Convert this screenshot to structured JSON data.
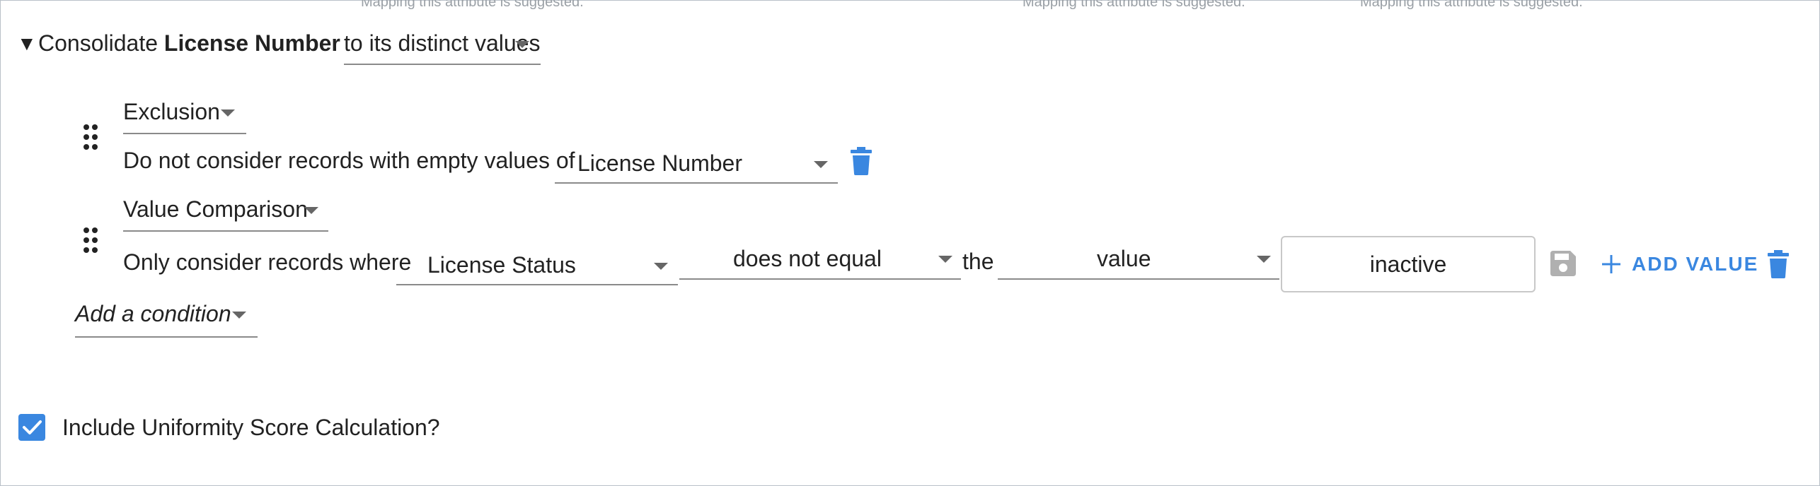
{
  "header_faint": {
    "left": "Mapping this attribute is suggested.",
    "mid": "Mapping this attribute is suggested.",
    "right": "Mapping this attribute is suggested."
  },
  "section": {
    "toggle": "▼",
    "prefix": "Consolidate",
    "attribute": "License Number",
    "mode": "to its distinct values"
  },
  "conditions": [
    {
      "type": "Exclusion",
      "text": "Do not consider records with empty values of",
      "field": "License Number"
    },
    {
      "type": "Value Comparison",
      "text": "Only consider records where",
      "field": "License Status",
      "operator": "does not equal",
      "connector": "the",
      "target": "value",
      "input_value": "inactive",
      "add_value_label": "ADD VALUE"
    }
  ],
  "add_condition": "Add a condition",
  "uniformity": {
    "checked": true,
    "label": "Include Uniformity Score Calculation?"
  },
  "colors": {
    "accent": "#3a87e0",
    "disabled_icon": "#b0b0b0"
  }
}
